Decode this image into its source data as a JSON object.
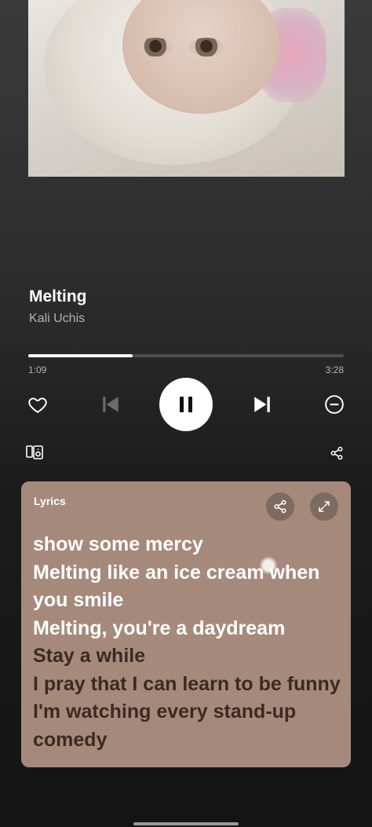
{
  "player": {
    "track_title": "Melting",
    "artist": "Kali Uchis",
    "elapsed": "1:09",
    "duration": "3:28",
    "progress_fraction": 0.33,
    "state": "playing"
  },
  "icons": {
    "like": "heart-icon",
    "previous": "skip-previous-icon",
    "play_pause": "pause-icon",
    "next": "skip-next-icon",
    "remove": "minus-circle-icon",
    "devices": "connect-devices-icon",
    "share": "share-icon",
    "expand": "expand-icon"
  },
  "lyrics": {
    "label": "Lyrics",
    "lines": [
      {
        "text": "show some mercy",
        "active": true
      },
      {
        "text": "Melting like an ice cream when",
        "active": true
      },
      {
        "text": "you smile",
        "active": true
      },
      {
        "text": "Melting, you're a daydream",
        "active": true
      },
      {
        "text": "Stay a while",
        "active": false
      },
      {
        "text": "I pray that I can learn to be funny",
        "active": false
      },
      {
        "text": "I'm watching every stand-up",
        "active": false
      },
      {
        "text": "comedy",
        "active": false
      }
    ]
  },
  "colors": {
    "lyrics_card": "#a58a7c",
    "active_line": "#ffffff",
    "upcoming_line": "#3a2a22",
    "accent": "#ffffff"
  }
}
